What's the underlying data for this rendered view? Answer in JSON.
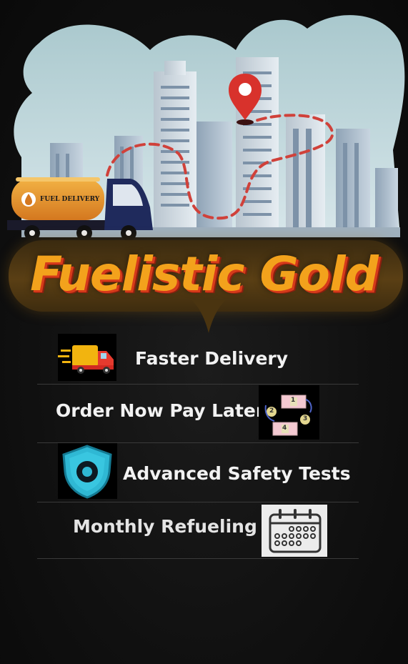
{
  "brand": {
    "title": "Fuelistic Gold"
  },
  "truck": {
    "tank_label": "FUEL DELIVERY"
  },
  "features": [
    {
      "label": "Faster Delivery",
      "icon": "delivery-truck-icon"
    },
    {
      "label": "Order Now Pay Later",
      "icon": "money-transfer-icon",
      "badges": [
        "1",
        "2",
        "3",
        "4"
      ]
    },
    {
      "label": "Advanced Safety Tests",
      "icon": "shield-icon"
    },
    {
      "label": "Monthly Refueling",
      "icon": "calendar-icon"
    }
  ],
  "colors": {
    "title": "#f3a21c",
    "title_shadow": "#d63a1a",
    "banner": "#5a3f14",
    "route": "#d0413a",
    "pin": "#d8322c",
    "shield": "#2fb8d4",
    "background": "#111111"
  }
}
